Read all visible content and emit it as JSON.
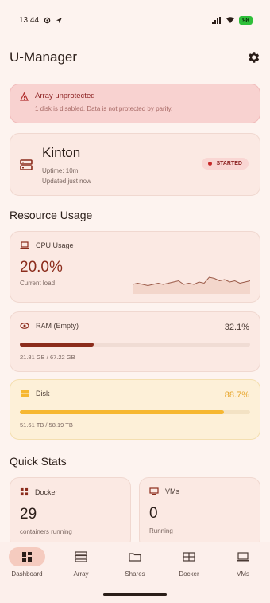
{
  "status_bar": {
    "time": "13:44",
    "battery": "98"
  },
  "header": {
    "title": "U-Manager",
    "settings_icon": "gear-icon"
  },
  "alert": {
    "title": "Array unprotected",
    "message": "1 disk is disabled. Data is not protected by parity.",
    "icon": "warning-icon"
  },
  "server": {
    "name": "Kinton",
    "uptime": "Uptime: 10m",
    "updated": "Updated just now",
    "status": "STARTED",
    "icon": "server-icon"
  },
  "resource_usage": {
    "title": "Resource Usage",
    "cpu": {
      "label": "CPU Usage",
      "value": "20.0%",
      "sub": "Current load",
      "sparkline": [
        8,
        9,
        8,
        7,
        8,
        9,
        8,
        9,
        10,
        11,
        8,
        9,
        8,
        10,
        9,
        14,
        13,
        11,
        12,
        10,
        11,
        9,
        10,
        11
      ]
    },
    "ram": {
      "label": "RAM (Empty)",
      "percent": "32.1%",
      "fraction": 0.321,
      "usage": "21.81 GB / 67.22 GB",
      "color": "#8b2c1c"
    },
    "disk": {
      "label": "Disk",
      "percent": "88.7%",
      "fraction": 0.887,
      "usage": "51.61 TB / 58.19 TB",
      "color": "#f6b731"
    }
  },
  "quick_stats": {
    "title": "Quick Stats",
    "docker": {
      "label": "Docker",
      "value": "29",
      "sub": "containers running"
    },
    "vms": {
      "label": "VMs",
      "value": "0",
      "sub": "Running"
    }
  },
  "nav": {
    "items": [
      {
        "label": "Dashboard",
        "icon": "dashboard-icon",
        "active": true
      },
      {
        "label": "Array",
        "icon": "array-icon"
      },
      {
        "label": "Shares",
        "icon": "shares-icon"
      },
      {
        "label": "Docker",
        "icon": "docker-icon"
      },
      {
        "label": "VMs",
        "icon": "vms-icon"
      }
    ]
  }
}
